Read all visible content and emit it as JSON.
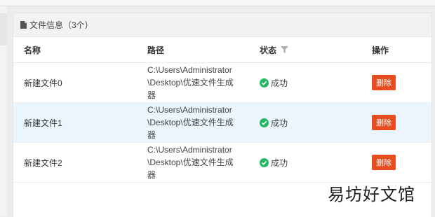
{
  "panel": {
    "title": "文件信息（3个）"
  },
  "table": {
    "headers": {
      "name": "名称",
      "path": "路径",
      "status": "状态",
      "action": "操作"
    },
    "rows": [
      {
        "name": "新建文件0",
        "path": "C:\\Users\\Administrator\\Desktop\\优速文件生成器",
        "status": "成功",
        "action": "删除"
      },
      {
        "name": "新建文件1",
        "path": "C:\\Users\\Administrator\\Desktop\\优速文件生成器",
        "status": "成功",
        "action": "删除"
      },
      {
        "name": "新建文件2",
        "path": "C:\\Users\\Administrator\\Desktop\\优速文件生成器",
        "status": "成功",
        "action": "删除"
      }
    ],
    "selected_row": 1
  },
  "watermark": "易坊好文馆",
  "colors": {
    "delete_button": "#e84c1f",
    "success": "#25b864",
    "selected_row": "#eaf5fd",
    "header_bg": "#f2f2f2"
  },
  "icons": {
    "panel": "file-icon",
    "status_filter": "filter-icon",
    "status_ok": "check-circle-icon"
  }
}
